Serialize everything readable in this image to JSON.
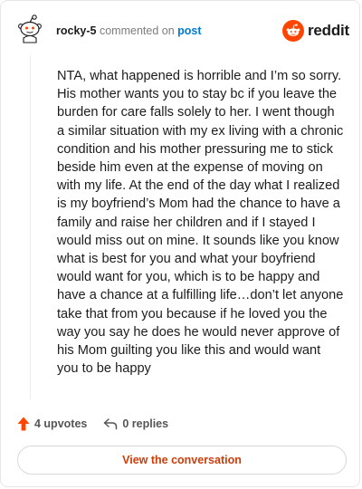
{
  "header": {
    "username": "rocky-5",
    "action_text": "commented on",
    "target_link": "post",
    "brand_name": "reddit"
  },
  "comment": {
    "body": "NTA, what happened is horrible and I’m so sorry. His mother wants you to stay bc if you leave the burden for care falls solely to her. I went though a similar situation with my ex living with a chronic condition and his mother pressuring me to stick beside him even at the expense of moving on with my life. At the end of the day what I realized is my boyfriend’s Mom had the chance to have a family and raise her children and if I stayed I would miss out on mine. It sounds like you know what is best for you and what your boyfriend would want for you, which is to be happy and have a chance at a fulfilling life…don’t let anyone take that from you because if he loved you the way you say he does he would never approve of his Mom guilting you like this and would want you to be happy"
  },
  "actions": {
    "upvotes_label": "4 upvotes",
    "replies_label": "0 replies"
  },
  "cta": {
    "label": "View the conversation"
  },
  "colors": {
    "accent": "#ff4500",
    "link": "#0079d3",
    "cta_text": "#cc3d0a"
  },
  "icons": {
    "avatar": "snoo-avatar-icon",
    "brand": "reddit-logo-icon",
    "upvote": "upvote-arrow-icon",
    "reply": "reply-arrow-icon"
  }
}
